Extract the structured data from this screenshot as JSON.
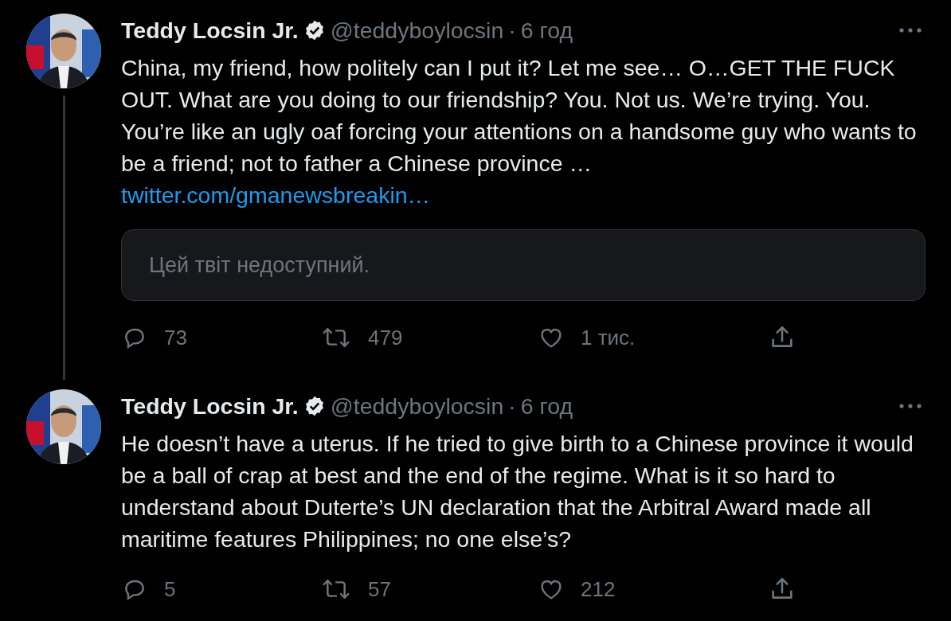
{
  "tweets": [
    {
      "author": "Teddy Locsin Jr.",
      "verified": true,
      "handle": "@teddyboylocsin",
      "separator": "·",
      "time": "6 год",
      "text": "China, my friend, how politely can I put it? Let me see… O…GET THE FUCK OUT. What are you doing to our friendship? You. Not us. We’re trying. You. You’re like an ugly oaf forcing your attentions on a handsome guy who wants to be a friend; not to father a Chinese province …",
      "link": "twitter.com/gmanewsbreakin…",
      "quoted": {
        "text": "Цей твіт недоступний."
      },
      "thread_line": true,
      "actions": {
        "replies": "73",
        "retweets": "479",
        "likes": "1 тис."
      }
    },
    {
      "author": "Teddy Locsin Jr.",
      "verified": true,
      "handle": "@teddyboylocsin",
      "separator": "·",
      "time": "6 год",
      "text": "He doesn’t have a uterus. If he tried to give birth to a Chinese province it would be a ball of crap at best and the end of the regime. What is it so hard to understand about Duterte’s UN declaration that the Arbitral Award made all maritime features Philippines; no one else’s?",
      "thread_line": false,
      "actions": {
        "replies": "5",
        "retweets": "57",
        "likes": "212"
      }
    }
  ]
}
